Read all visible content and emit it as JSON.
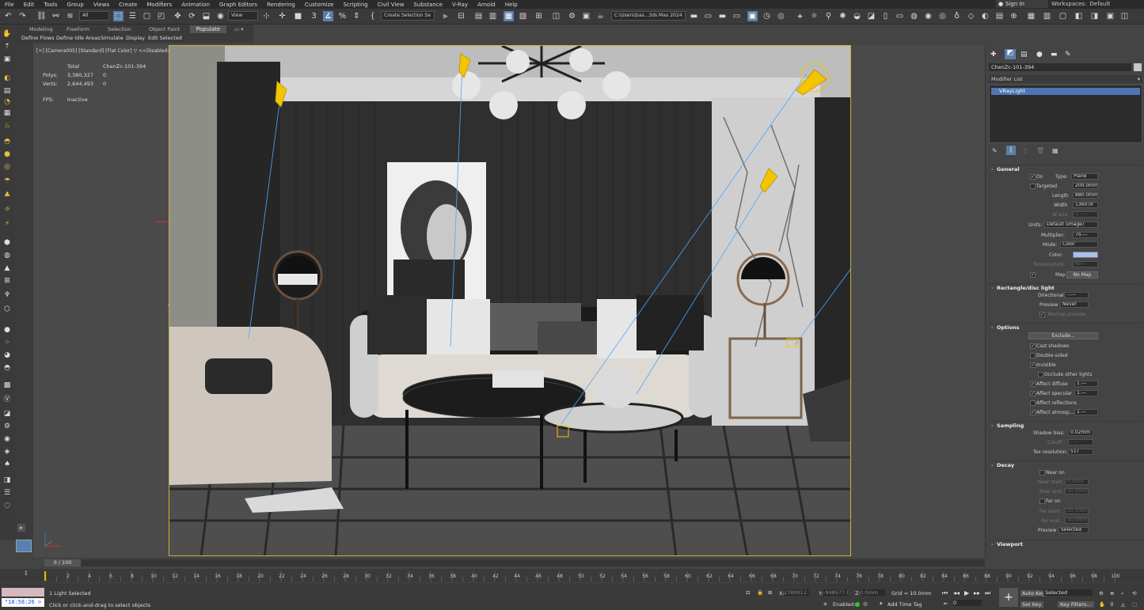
{
  "menu": [
    "File",
    "Edit",
    "Tools",
    "Group",
    "Views",
    "Create",
    "Modifiers",
    "Animation",
    "Graph Editors",
    "Rendering",
    "Customize",
    "Scripting",
    "Civil View",
    "Substance",
    "V-Ray",
    "Arnold",
    "Help"
  ],
  "account": {
    "sign_in": "Sign In",
    "workspaces_label": "Workspaces:",
    "workspace_value": "Default"
  },
  "toolbar": {
    "filter_value": "All",
    "refcoord_value": "View",
    "selection_set_placeholder": "Create Selection Se",
    "project_path": "C:\\Users\\bas...3ds Max 2024"
  },
  "ribbon": {
    "tabs": [
      "Modeling",
      "Freeform",
      "Selection",
      "Object Paint",
      "Populate"
    ],
    "subtabs": [
      "Define Flows",
      "Define Idle Areas",
      "Simulate",
      "Display",
      "Edit Selected"
    ]
  },
  "viewport": {
    "label_plus": "[+]",
    "label_camera": "[Camera005]",
    "label_standard": "[Standard]",
    "label_shading": "[Flat Color]",
    "label_disabled": "<<Disabled>>",
    "stats": {
      "col_total": "Total",
      "col_object": "ChenZc-101-394",
      "polys_label": "Polys:",
      "polys_total": "3,380,327",
      "polys_obj": "0",
      "verts_label": "Verts:",
      "verts_total": "2,644,493",
      "verts_obj": "0",
      "fps_label": "FPS:",
      "fps_value": "Inactive"
    }
  },
  "panel": {
    "object_name": "ChenZc-101-394",
    "modifier_list": "Modifier List",
    "stack_item": "VRayLight",
    "general": {
      "title": "General",
      "on_label": "On",
      "type_label": "Type:",
      "type_value": "Plane",
      "targeted_label": "Targeted",
      "targeted_value": "200.0mm",
      "length_label": "Length",
      "length_value": "880.0mm",
      "width_label": "Width",
      "width_value": "1360.0r",
      "wsize_label": "W size",
      "wsize_value": "1.----",
      "units_label": "Units:",
      "units_value": "Default (image)",
      "multiplier_label": "Multiplier:",
      "multiplier_value": "7o.---",
      "mode_label": "Mode:",
      "mode_value": "Color",
      "color_label": "Color:",
      "color_hex": "#a9c1f0",
      "temperature_label": "Temperature:",
      "temperature_value": "6o---",
      "map_label": "Map",
      "map_button": "No Map"
    },
    "rect": {
      "title": "Rectangle/disc light",
      "directional_label": "Directional",
      "directional_value": "-.---",
      "preview_label": "Preview",
      "preview_value": "Never",
      "texmap_label": "Texmap preview"
    },
    "options": {
      "title": "Options",
      "exclude_button": "Exclude...",
      "cast_shadows": "Cast shadows",
      "double_sided": "Double-sided",
      "invisible": "Invisible",
      "occlude": "Occlude other lights",
      "affect_diffuse": "Affect diffuse",
      "affect_diffuse_value": "1.---",
      "affect_specular": "Affect specular",
      "affect_specular_value": "1.---",
      "affect_reflections": "Affect reflections",
      "affect_atmosp": "Affect atmosp...",
      "affect_atmosp_value": "1.---"
    },
    "sampling": {
      "title": "Sampling",
      "shadow_bias_label": "Shadow bias:",
      "shadow_bias_value": "0.02mm",
      "cutoff_label": "Cutoff:",
      "cutoff_value": "-.---",
      "texres_label": "Tex resolution:",
      "texres_value": "51T"
    },
    "decay": {
      "title": "Decay",
      "near_on": "Near on",
      "near_start_label": "Near start:",
      "near_start_value": "0.0mm",
      "near_end_label": "Near end:",
      "near_end_value": "10.0mm",
      "far_on": "Far on",
      "far_start_label": "Far start:",
      "far_start_value": "20.0mm",
      "far_end_label": "Far end:",
      "far_end_value": "30.0mm",
      "preview_label": "Preview",
      "preview_value": "Selected"
    },
    "viewport_title": "Viewport"
  },
  "timeline": {
    "frame_display": "0 / 100",
    "ticks": [
      "2",
      "4",
      "6",
      "8",
      "10",
      "12",
      "14",
      "16",
      "18",
      "20",
      "22",
      "24",
      "26",
      "28",
      "30",
      "32",
      "34",
      "36",
      "38",
      "40",
      "42",
      "44",
      "46",
      "48",
      "50",
      "52",
      "54",
      "56",
      "58",
      "60",
      "62",
      "64",
      "66",
      "68",
      "70",
      "72",
      "74",
      "76",
      "78",
      "80",
      "82",
      "84",
      "86",
      "88",
      "90",
      "92",
      "94",
      "96",
      "98",
      "100"
    ]
  },
  "status": {
    "clock": "\"18:58:26 >",
    "selection_msg": "1 Light Selected",
    "prompt_msg": "Click or click-and-drag to select objects",
    "x_label": "X:",
    "x_value": "2780012.1",
    "y_label": "Y:",
    "y_value": "-948577.0r",
    "z_label": "Z:",
    "z_value": "0.0mm",
    "grid": "Grid = 10.0mm",
    "enabled_label": "Enabled:",
    "add_time_tag": "Add Time Tag",
    "auto_key": "Auto Key",
    "set_key": "Set Key",
    "selected_value": "Selected",
    "key_filters": "Key Filters...",
    "frame_spinner": "0"
  }
}
